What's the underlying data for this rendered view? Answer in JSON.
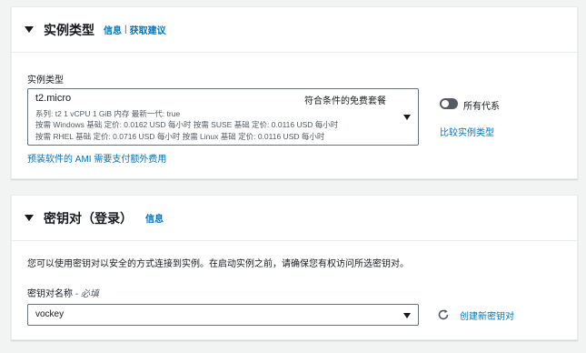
{
  "instance_type_section": {
    "title": "实例类型",
    "info_link": "信息",
    "separator": "|",
    "advice_link": "获取建议",
    "field_label": "实例类型",
    "selected": {
      "name": "t2.micro",
      "tag": "符合条件的免费套餐",
      "row1": "系列: t2    1 vCPU    1 GiB 内存    最新一代: true",
      "row2": "按需 Windows 基础 定价: 0.0162 USD 每小时    按需 SUSE 基础 定价: 0.0116 USD 每小时",
      "row3": "按需 RHEL 基础 定价: 0.0716 USD 每小时    按需 Linux 基础 定价: 0.0116 USD 每小时"
    },
    "all_generations_label": "所有代系",
    "compare_link": "比较实例类型",
    "ami_note_link": "预装软件的 AMI 需要支付额外费用"
  },
  "keypair_section": {
    "title": "密钥对（登录）",
    "info_link": "信息",
    "description": "您可以使用密钥对以安全的方式连接到实例。在启动实例之前，请确保您有权访问所选密钥对。",
    "field_label": "密钥对名称",
    "field_required": " - 必填",
    "selected_value": "vockey",
    "create_link": "创建新密钥对"
  },
  "icons": {
    "caret": "caret-down-icon",
    "refresh": "refresh-icon"
  },
  "colors": {
    "link": "#0073bb",
    "toggle_off": "#545b64",
    "text": "#16191f"
  }
}
